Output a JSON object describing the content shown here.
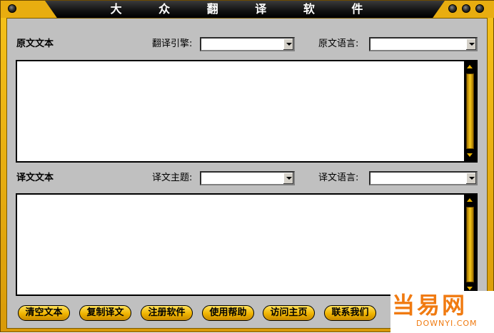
{
  "window": {
    "title": "大 众 翻 译 软 件",
    "accent_color": "#f0b400",
    "title_bar_color": "#000000"
  },
  "source_section": {
    "heading": "原文文本",
    "engine_label": "翻译引擎:",
    "engine_value": "",
    "language_label": "原文语言:",
    "language_value": "",
    "text": ""
  },
  "target_section": {
    "heading": "译文文本",
    "topic_label": "译文主题:",
    "topic_value": "",
    "language_label": "译文语言:",
    "language_value": "",
    "text": ""
  },
  "buttons": {
    "clear": "清空文本",
    "copy": "复制译文",
    "register": "注册软件",
    "help": "使用帮助",
    "homepage": "访问主页",
    "contact": "联系我们"
  },
  "watermark": {
    "main": "当易网",
    "sub": "DOWNYI.COM"
  }
}
